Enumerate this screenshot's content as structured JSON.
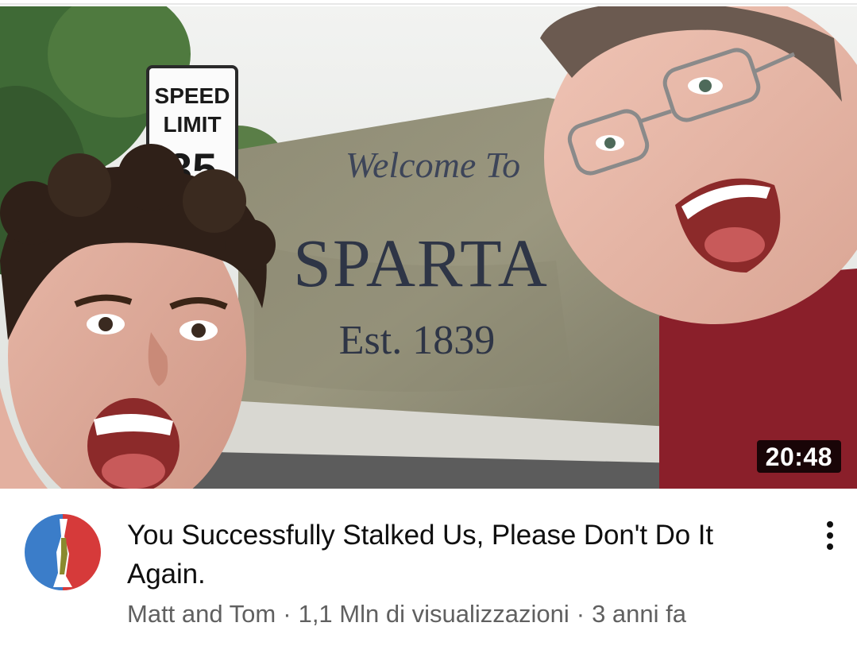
{
  "video": {
    "duration": "20:48",
    "title": "You Successfully Stalked Us, Please Don't Do It Again.",
    "channel": "Matt and Tom",
    "separator": "·",
    "views": "1,1 Mln di visualizzazioni",
    "age": "3 anni fa"
  },
  "thumbnail": {
    "speed_sign": {
      "line1": "SPEED",
      "line2": "LIMIT",
      "number": "35"
    },
    "town_sign": {
      "welcome": "Welcome To",
      "town": "SPARTA",
      "established": "Est. 1839"
    }
  },
  "icons": {
    "more": "more-vertical-icon",
    "avatar": "channel-avatar-icon"
  },
  "colors": {
    "title_text": "#0f0f0f",
    "meta_text": "#606060",
    "badge_bg": "#000000",
    "avatar_blue": "#3b7dc9",
    "avatar_red": "#d63a3a"
  }
}
